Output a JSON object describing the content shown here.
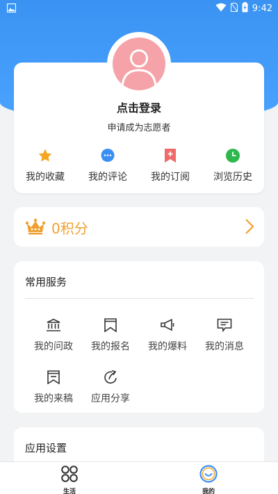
{
  "status_bar": {
    "time": "9:42",
    "left_icon": "image-icon",
    "icons": [
      "wifi-icon",
      "sim-off-icon",
      "battery-charging-icon"
    ]
  },
  "profile": {
    "login_label": "点击登录",
    "volunteer_label": "申请成为志愿者",
    "quick_actions": [
      {
        "label": "我的收藏",
        "icon": "star-icon",
        "color": "#f5a623"
      },
      {
        "label": "我的评论",
        "icon": "comment-icon",
        "color": "#3a8ff5"
      },
      {
        "label": "我的订阅",
        "icon": "bookmark-add-icon",
        "color": "#f06a6a"
      },
      {
        "label": "浏览历史",
        "icon": "clock-icon",
        "color": "#2db84d"
      }
    ]
  },
  "points": {
    "text": "0积分",
    "color": "#f0a030"
  },
  "services": {
    "title": "常用服务",
    "items": [
      {
        "label": "我的问政",
        "icon": "government-icon"
      },
      {
        "label": "我的报名",
        "icon": "signup-bookmark-icon"
      },
      {
        "label": "我的爆料",
        "icon": "megaphone-icon"
      },
      {
        "label": "我的消息",
        "icon": "message-icon"
      },
      {
        "label": "我的来稿",
        "icon": "manuscript-icon"
      },
      {
        "label": "应用分享",
        "icon": "share-icon"
      }
    ]
  },
  "settings": {
    "title": "应用设置"
  },
  "tabbar": {
    "tabs": [
      {
        "label": "生活",
        "icon": "grid-circles-icon",
        "active": false
      },
      {
        "label": "我的",
        "icon": "smile-icon",
        "active": true
      }
    ]
  },
  "colors": {
    "header": "#3a93f2",
    "accent": "#f0a030",
    "active_tab": "#3a8ff5"
  }
}
